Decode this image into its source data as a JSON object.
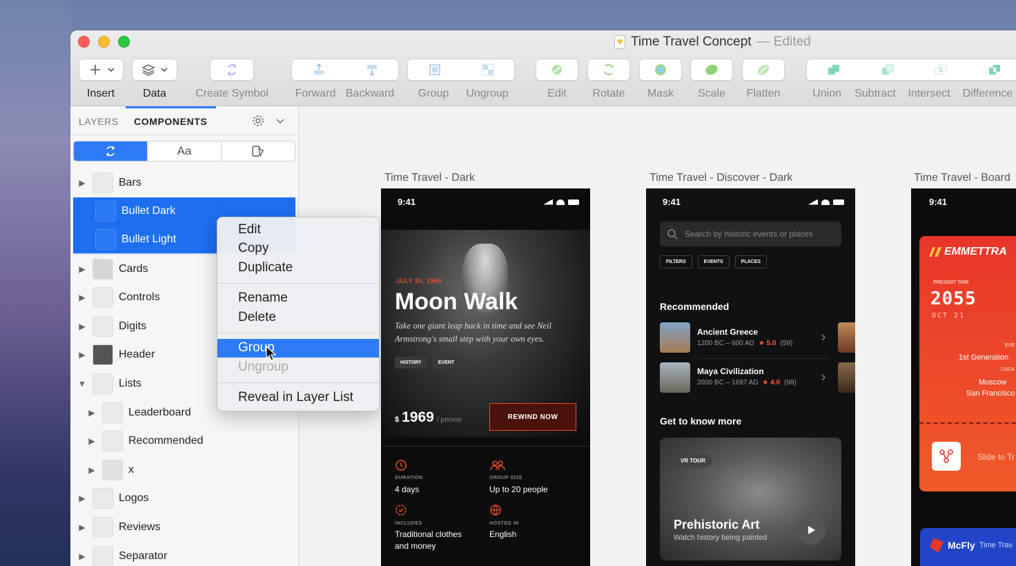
{
  "window": {
    "title": "Time Travel Concept",
    "title_suffix": "— Edited"
  },
  "toolbar": {
    "insert": "Insert",
    "data": "Data",
    "create_symbol": "Create Symbol",
    "forward": "Forward",
    "backward": "Backward",
    "group": "Group",
    "ungroup": "Ungroup",
    "edit": "Edit",
    "rotate": "Rotate",
    "mask": "Mask",
    "scale": "Scale",
    "flatten": "Flatten",
    "union": "Union",
    "subtract": "Subtract",
    "intersect": "Intersect",
    "difference": "Difference"
  },
  "sidebar": {
    "tab_layers": "LAYERS",
    "tab_components": "COMPONENTS",
    "seg_text": "Aa",
    "items": [
      {
        "label": "Bars"
      },
      {
        "label": "Bullet Dark"
      },
      {
        "label": "Bullet Light"
      },
      {
        "label": "Cards"
      },
      {
        "label": "Controls"
      },
      {
        "label": "Digits"
      },
      {
        "label": "Header"
      },
      {
        "label": "Lists"
      },
      {
        "label": "Leaderboard"
      },
      {
        "label": "Recommended"
      },
      {
        "label": "x"
      },
      {
        "label": "Logos"
      },
      {
        "label": "Reviews"
      },
      {
        "label": "Separator"
      }
    ]
  },
  "context_menu": {
    "items": [
      "Edit",
      "Copy",
      "Duplicate",
      "Rename",
      "Delete",
      "Group",
      "Ungroup",
      "Reveal in Layer List"
    ]
  },
  "artboards": {
    "a1_title": "Time Travel - Dark",
    "a2_title": "Time Travel - Discover - Dark",
    "a3_title": "Time Travel - Board",
    "time": "9:41"
  },
  "moonwalk": {
    "date": "JULY 20, 1969",
    "title": "Moon Walk",
    "desc": "Take one giant leap back in time and see Neil Armstrong's small step with your own eyes.",
    "tag1": "HISTORY",
    "tag2": "EVENT",
    "currency": "$",
    "price": "1969",
    "per": "/ person",
    "cta": "REWIND NOW",
    "duration_label": "DURATION",
    "duration": "4 days",
    "group_label": "GROUP SIZE",
    "group": "Up to 20 people",
    "includes_label": "INCLUDES",
    "includes": "Traditional clothes and money",
    "hosted_label": "HOSTED IN",
    "hosted": "English"
  },
  "discover": {
    "search_placeholder": "Search by historic events or places",
    "filter1": "FILTERS",
    "filter2": "EVENTS",
    "filter3": "PLACES",
    "recommended": "Recommended",
    "item1_title": "Ancient Greece",
    "item1_sub": "1200 BC – 600 AD",
    "item1_rating": "★ 5.0",
    "item1_count": "(59)",
    "item2_title": "Maya Civilization",
    "item2_sub": "2000 BC – 1697 AD",
    "item2_rating": "★ 4.0",
    "item2_count": "(98)",
    "get_to_know": "Get to know more",
    "vr_tag": "VR TOUR",
    "card_title": "Prehistoric Art",
    "card_sub": "Watch history being painted"
  },
  "board": {
    "brand": "EMMETTRA",
    "present_time": "PRESENT TIME",
    "year": "2055",
    "date": "OCT 21",
    "event_label": "EVE",
    "event": "1st Generation",
    "loc_label": "LOCA",
    "loc1": "Moscow",
    "loc2": "San Francisco",
    "slide": "Slide to Tr",
    "mcfly": "McFly",
    "mcfly_sub": "Time Trav"
  },
  "colors": {
    "accent": "#2f7bf5",
    "orange": "#e8502c",
    "rating": "#ff5a3c"
  }
}
